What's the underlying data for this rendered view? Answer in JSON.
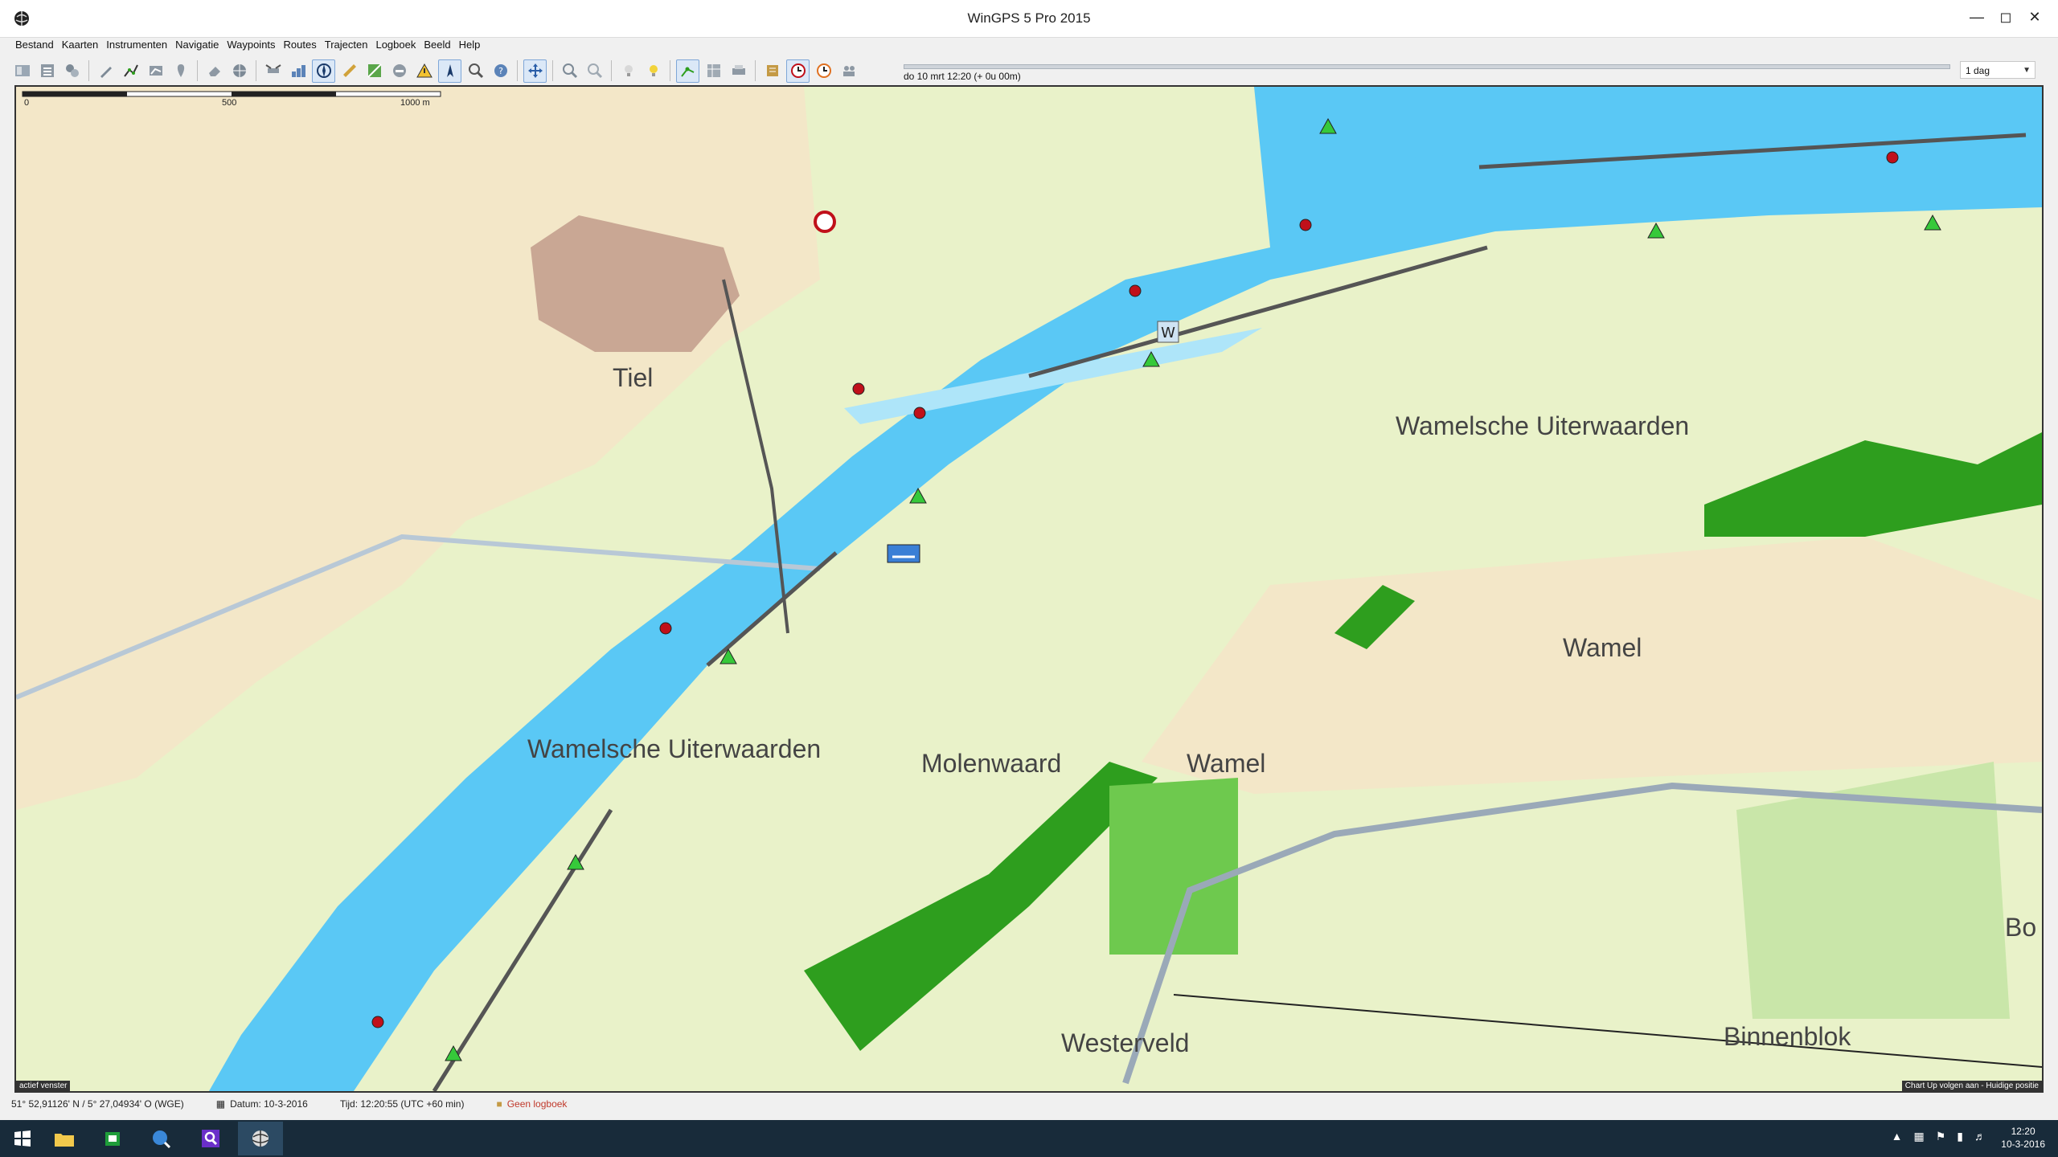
{
  "window": {
    "title": "WinGPS 5 Pro 2015",
    "minimize_icon": "minimize-icon",
    "maximize_icon": "maximize-icon",
    "close_icon": "close-icon"
  },
  "menu": [
    "Bestand",
    "Kaarten",
    "Instrumenten",
    "Navigatie",
    "Waypoints",
    "Routes",
    "Trajecten",
    "Logboek",
    "Beeld",
    "Help"
  ],
  "timebar": {
    "label": "do 10 mrt 12:20  (+ 0u 00m)",
    "range_select": "1 dag"
  },
  "map": {
    "scale": {
      "zero": "0",
      "mid": "500",
      "end": "1000 m"
    },
    "labels": {
      "tiel": "Tiel",
      "wamelsche_uiterwaarden_ne": "Wamelsche Uiterwaarden",
      "wamelsche_uiterwaarden_w": "Wamelsche Uiterwaarden",
      "molenwaard": "Molenwaard",
      "wamel_center": "Wamel",
      "wamel_east": "Wamel",
      "westerveld": "Westerveld",
      "binnenblok": "Binnenblok",
      "bo": "Bo"
    },
    "corner_left": "actief venster",
    "corner_right": "Chart Up volgen aan - Huidige positie"
  },
  "status": {
    "position": "51° 52,91126' N / 5° 27,04934' O (WGE)",
    "date": "Datum: 10-3-2016",
    "time": "Tijd: 12:20:55 (UTC +60 min)",
    "logbook": "Geen logboek"
  },
  "taskbar": {
    "time": "12:20",
    "date": "10-3-2016"
  },
  "colors": {
    "water": "#5ac8f5",
    "land": "#e9f2c9",
    "urban": "#f3e7c8",
    "forest": "#2e9e1e",
    "buoy_red": "#c0101a",
    "buoy_green": "#36c93a"
  }
}
